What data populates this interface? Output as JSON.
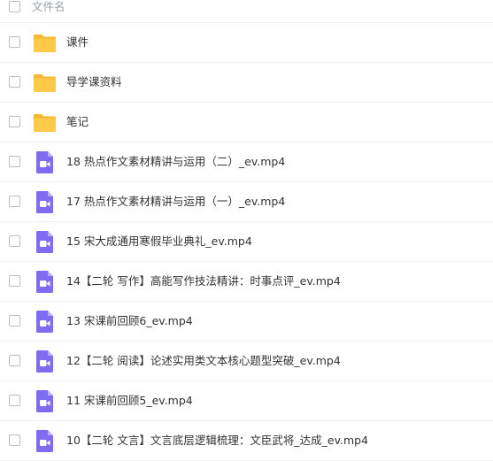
{
  "header": {
    "column_title": "文件名"
  },
  "colors": {
    "folder": "#ffc94a",
    "folder_tab": "#f7b731",
    "video": "#7e6df2"
  },
  "files": [
    {
      "name": "课件",
      "icon": "folder-icon"
    },
    {
      "name": "导学课资料",
      "icon": "folder-icon"
    },
    {
      "name": "笔记",
      "icon": "folder-icon"
    },
    {
      "name": "18 热点作文素材精讲与运用（二）_ev.mp4",
      "icon": "video-file-icon"
    },
    {
      "name": "17 热点作文素材精讲与运用（一）_ev.mp4",
      "icon": "video-file-icon"
    },
    {
      "name": "15 宋大成通用寒假毕业典礼_ev.mp4",
      "icon": "video-file-icon"
    },
    {
      "name": "14【二轮 写作】高能写作技法精讲：时事点评_ev.mp4",
      "icon": "video-file-icon"
    },
    {
      "name": "13 宋课前回顾6_ev.mp4",
      "icon": "video-file-icon"
    },
    {
      "name": "12【二轮 阅读】论述实用类文本核心题型突破_ev.mp4",
      "icon": "video-file-icon"
    },
    {
      "name": "11 宋课前回顾5_ev.mp4",
      "icon": "video-file-icon"
    },
    {
      "name": "10【二轮 文言】文言底层逻辑梳理：文臣武将_达成_ev.mp4",
      "icon": "video-file-icon"
    }
  ]
}
